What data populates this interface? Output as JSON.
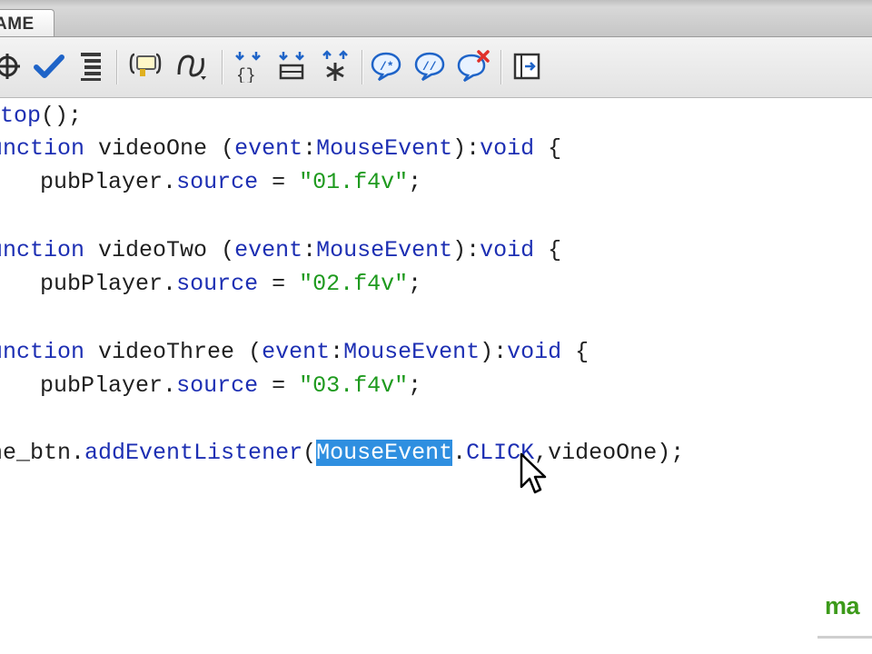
{
  "tab": {
    "label": "AME"
  },
  "toolbar": {
    "icons": [
      "crosshair-icon",
      "check-syntax-icon",
      "auto-format-icon",
      "code-hint-icon",
      "debug-options-icon",
      "collapse-between-braces-icon",
      "collapse-selection-icon",
      "expand-all-icon",
      "apply-block-comment-icon",
      "apply-line-comment-icon",
      "remove-comment-icon",
      "show-hide-toolbox-icon"
    ]
  },
  "code": {
    "line1": {
      "a": "top",
      "b": "();"
    },
    "line2": {
      "kw": "unction",
      "name": " videoOne ",
      "p1": "(",
      "param": "event",
      "colon": ":",
      "type": "MouseEvent",
      "p2": "):",
      "ret": "void",
      "brace": " {"
    },
    "line3": {
      "indent": "    ",
      "obj": "pubPlayer",
      "dot": ".",
      "prop": "source",
      "eq": " = ",
      "str": "\"01.f4v\"",
      "semi": ";"
    },
    "line5": {
      "kw": "unction",
      "name": " videoTwo ",
      "p1": "(",
      "param": "event",
      "colon": ":",
      "type": "MouseEvent",
      "p2": "):",
      "ret": "void",
      "brace": " {"
    },
    "line6": {
      "indent": "    ",
      "obj": "pubPlayer",
      "dot": ".",
      "prop": "source",
      "eq": " = ",
      "str": "\"02.f4v\"",
      "semi": ";"
    },
    "line8": {
      "kw": "unction",
      "name": " videoThree ",
      "p1": "(",
      "param": "event",
      "colon": ":",
      "type": "MouseEvent",
      "p2": "):",
      "ret": "void",
      "brace": " {"
    },
    "line9": {
      "indent": "    ",
      "obj": "pubPlayer",
      "dot": ".",
      "prop": "source",
      "eq": " = ",
      "str": "\"03.f4v\"",
      "semi": ";"
    },
    "line11": {
      "obj": "ne_btn",
      "dot": ".",
      "method": "addEventListener",
      "p1": "(",
      "selected": "MouseEvent",
      "rest_dot": ".",
      "const": "CLICK",
      "comma": ",",
      "handler": "videoOne",
      "end": ");"
    }
  },
  "watermark": {
    "text": "ma"
  },
  "colors": {
    "keyword": "#1d2fb3",
    "string": "#1e9a1e",
    "selection": "#2f8fe0",
    "watermark": "#3c9a1a"
  }
}
